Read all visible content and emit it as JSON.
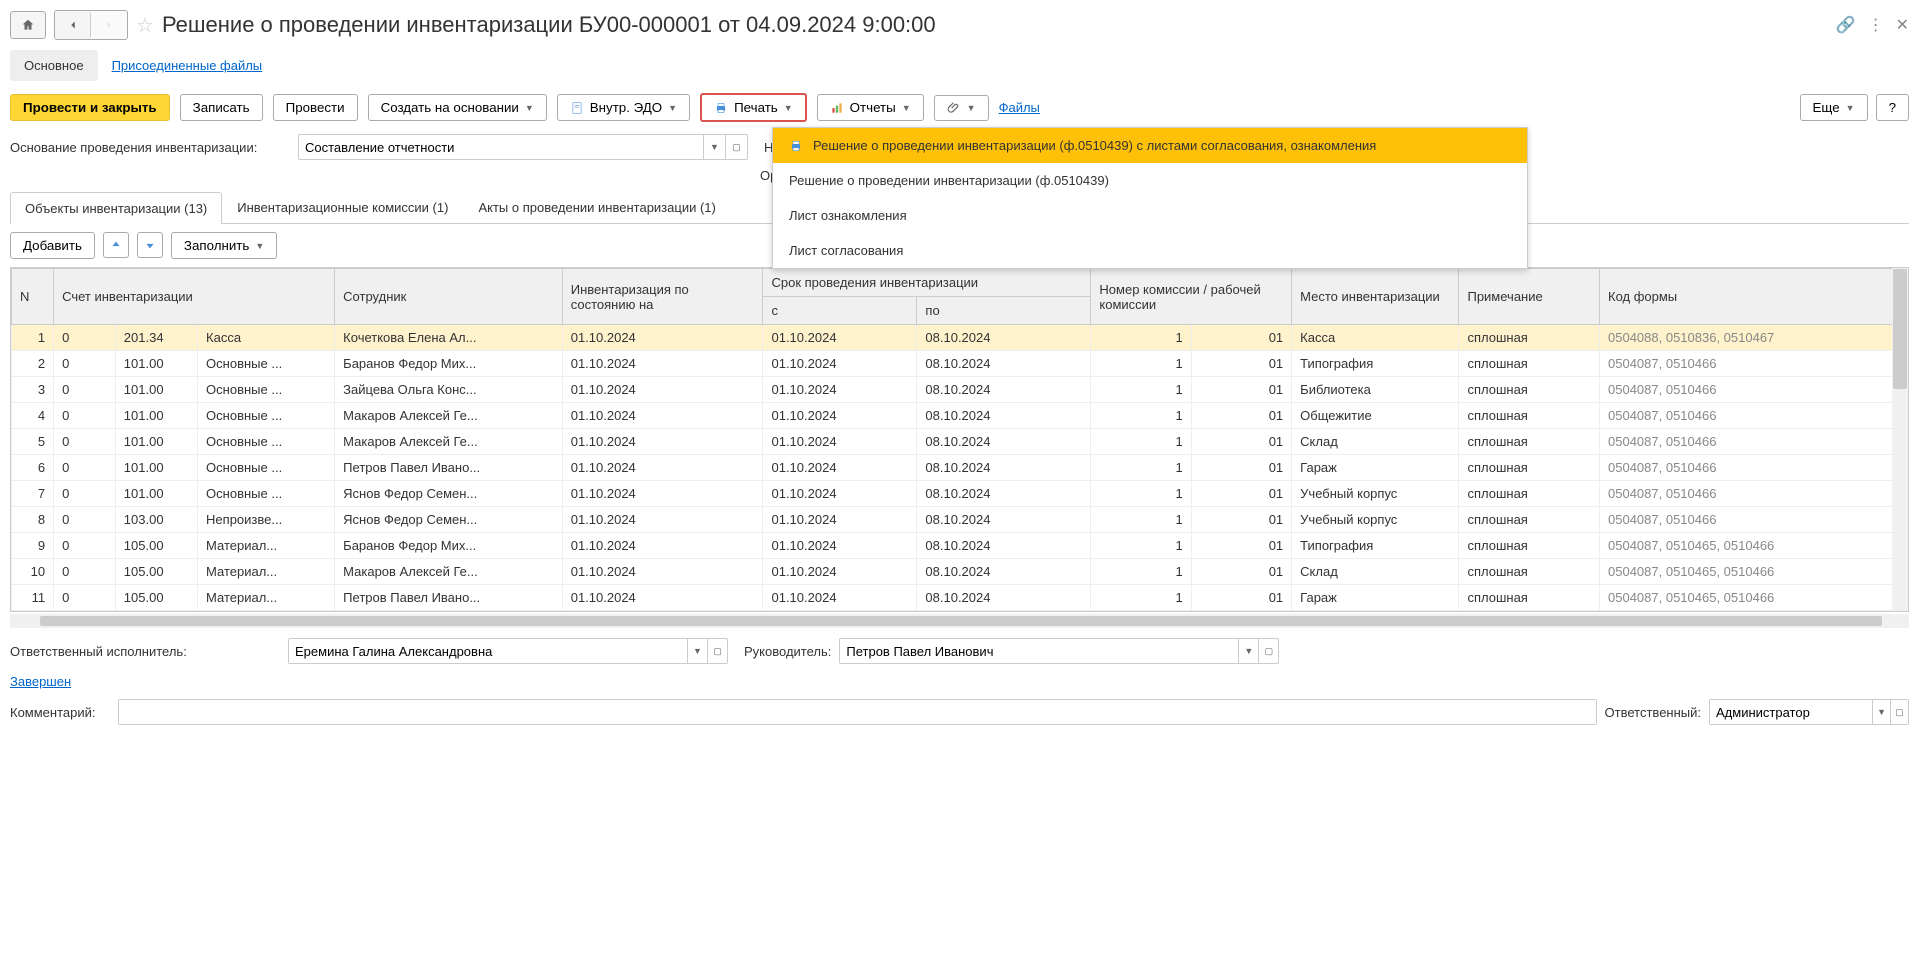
{
  "title": "Решение о проведении инвентаризации БУ00-000001 от 04.09.2024 9:00:00",
  "navTabs": {
    "main": "Основное",
    "files": "Присоединенные файлы"
  },
  "toolbar": {
    "postClose": "Провести и закрыть",
    "save": "Записать",
    "post": "Провести",
    "createBased": "Создать на основании",
    "edo": "Внутр. ЭДО",
    "print": "Печать",
    "reports": "Отчеты",
    "files": "Файлы",
    "more": "Еще",
    "help": "?"
  },
  "printMenu": {
    "item1": "Решение о проведении инвентаризации (ф.0510439) с листами согласования, ознакомления",
    "item2": "Решение о проведении инвентаризации (ф.0510439)",
    "item3": "Лист ознакомления",
    "item4": "Лист согласования"
  },
  "form": {
    "reasonLabel": "Основание проведения инвентаризации:",
    "reason": "Составление отчетности",
    "orgPrefix": "Ор"
  },
  "contentTabs": {
    "t1": "Объекты инвентаризации (13)",
    "t2": "Инвентаризационные комиссии (1)",
    "t3": "Акты о проведении инвентаризации (1)"
  },
  "tabToolbar": {
    "add": "Добавить",
    "fill": "Заполнить"
  },
  "headers": {
    "n": "N",
    "account": "Счет инвентаризации",
    "employee": "Сотрудник",
    "asOf": "Инвентаризация по состоянию на",
    "period": "Срок проведения инвентаризации",
    "from": "с",
    "to": "по",
    "commission": "Номер комиссии / рабочей комиссии",
    "place": "Место инвентаризации",
    "note": "Примечание",
    "formCode": "Код формы"
  },
  "rows": [
    {
      "n": "1",
      "a1": "0",
      "a2": "201.34",
      "a3": "Касса",
      "emp": "Кочеткова Елена Ал...",
      "asOf": "01.10.2024",
      "from": "01.10.2024",
      "to": "08.10.2024",
      "c1": "1",
      "c2": "01",
      "place": "Касса",
      "note": "сплошная",
      "codes": "0504088, 0510836, 0510467"
    },
    {
      "n": "2",
      "a1": "0",
      "a2": "101.00",
      "a3": "Основные ...",
      "emp": "Баранов Федор Мих...",
      "asOf": "01.10.2024",
      "from": "01.10.2024",
      "to": "08.10.2024",
      "c1": "1",
      "c2": "01",
      "place": "Типография",
      "note": "сплошная",
      "codes": "0504087, 0510466"
    },
    {
      "n": "3",
      "a1": "0",
      "a2": "101.00",
      "a3": "Основные ...",
      "emp": "Зайцева Ольга Конс...",
      "asOf": "01.10.2024",
      "from": "01.10.2024",
      "to": "08.10.2024",
      "c1": "1",
      "c2": "01",
      "place": "Библиотека",
      "note": "сплошная",
      "codes": "0504087, 0510466"
    },
    {
      "n": "4",
      "a1": "0",
      "a2": "101.00",
      "a3": "Основные ...",
      "emp": "Макаров Алексей Ге...",
      "asOf": "01.10.2024",
      "from": "01.10.2024",
      "to": "08.10.2024",
      "c1": "1",
      "c2": "01",
      "place": "Общежитие",
      "note": "сплошная",
      "codes": "0504087, 0510466"
    },
    {
      "n": "5",
      "a1": "0",
      "a2": "101.00",
      "a3": "Основные ...",
      "emp": "Макаров Алексей Ге...",
      "asOf": "01.10.2024",
      "from": "01.10.2024",
      "to": "08.10.2024",
      "c1": "1",
      "c2": "01",
      "place": "Склад",
      "note": "сплошная",
      "codes": "0504087, 0510466"
    },
    {
      "n": "6",
      "a1": "0",
      "a2": "101.00",
      "a3": "Основные ...",
      "emp": "Петров Павел Ивано...",
      "asOf": "01.10.2024",
      "from": "01.10.2024",
      "to": "08.10.2024",
      "c1": "1",
      "c2": "01",
      "place": "Гараж",
      "note": "сплошная",
      "codes": "0504087, 0510466"
    },
    {
      "n": "7",
      "a1": "0",
      "a2": "101.00",
      "a3": "Основные ...",
      "emp": "Яснов Федор Семен...",
      "asOf": "01.10.2024",
      "from": "01.10.2024",
      "to": "08.10.2024",
      "c1": "1",
      "c2": "01",
      "place": "Учебный корпус",
      "note": "сплошная",
      "codes": "0504087, 0510466"
    },
    {
      "n": "8",
      "a1": "0",
      "a2": "103.00",
      "a3": "Непроизве...",
      "emp": "Яснов Федор Семен...",
      "asOf": "01.10.2024",
      "from": "01.10.2024",
      "to": "08.10.2024",
      "c1": "1",
      "c2": "01",
      "place": "Учебный корпус",
      "note": "сплошная",
      "codes": "0504087, 0510466"
    },
    {
      "n": "9",
      "a1": "0",
      "a2": "105.00",
      "a3": "Материал...",
      "emp": "Баранов Федор Мих...",
      "asOf": "01.10.2024",
      "from": "01.10.2024",
      "to": "08.10.2024",
      "c1": "1",
      "c2": "01",
      "place": "Типография",
      "note": "сплошная",
      "codes": "0504087, 0510465, 0510466"
    },
    {
      "n": "10",
      "a1": "0",
      "a2": "105.00",
      "a3": "Материал...",
      "emp": "Макаров Алексей Ге...",
      "asOf": "01.10.2024",
      "from": "01.10.2024",
      "to": "08.10.2024",
      "c1": "1",
      "c2": "01",
      "place": "Склад",
      "note": "сплошная",
      "codes": "0504087, 0510465, 0510466"
    },
    {
      "n": "11",
      "a1": "0",
      "a2": "105.00",
      "a3": "Материал...",
      "emp": "Петров Павел Ивано...",
      "asOf": "01.10.2024",
      "from": "01.10.2024",
      "to": "08.10.2024",
      "c1": "1",
      "c2": "01",
      "place": "Гараж",
      "note": "сплошная",
      "codes": "0504087, 0510465, 0510466"
    }
  ],
  "footer": {
    "respExecLabel": "Ответственный исполнитель:",
    "respExec": "Еремина Галина Александровна",
    "headLabel": "Руководитель:",
    "head": "Петров Павел Иванович",
    "completed": "Завершен",
    "commentLabel": "Комментарий:",
    "comment": "",
    "responsibleLabel": "Ответственный:",
    "responsible": "Администратор"
  }
}
